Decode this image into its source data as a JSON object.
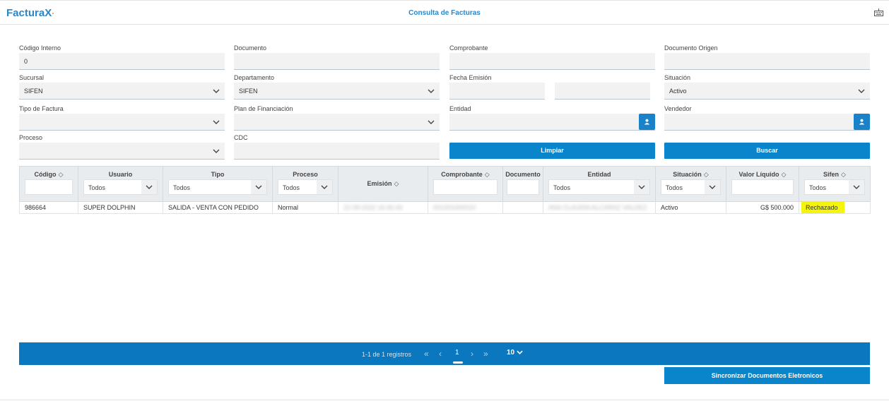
{
  "app": {
    "logo_main": "Factura",
    "logo_x": "X",
    "logo_dot": "·",
    "title": "Consulta de Facturas"
  },
  "filters": {
    "codigo_interno": {
      "label": "Código Interno",
      "value": "0"
    },
    "documento": {
      "label": "Documento",
      "value": ""
    },
    "comprobante": {
      "label": "Comprobante",
      "value": ""
    },
    "documento_origen": {
      "label": "Documento Origen",
      "value": ""
    },
    "sucursal": {
      "label": "Sucursal",
      "value": "SIFEN"
    },
    "departamento": {
      "label": "Departamento",
      "value": "SIFEN"
    },
    "fecha_emision": {
      "label": "Fecha Emisión",
      "from": "",
      "to": ""
    },
    "situacion": {
      "label": "Situación",
      "value": "Activo"
    },
    "tipo_factura": {
      "label": "Tipo de Factura",
      "value": ""
    },
    "plan_financiacion": {
      "label": "Plan de Financiación",
      "value": ""
    },
    "entidad": {
      "label": "Entidad",
      "value": ""
    },
    "vendedor": {
      "label": "Vendedor",
      "value": ""
    },
    "proceso": {
      "label": "Proceso",
      "value": ""
    },
    "cdc": {
      "label": "CDC",
      "value": ""
    }
  },
  "buttons": {
    "limpiar": "Limpiar",
    "buscar": "Buscar",
    "sincronizar": "Sincronizar Documentos Eletronicos"
  },
  "table": {
    "headers": {
      "codigo": "Código",
      "usuario": "Usuario",
      "tipo": "Tipo",
      "proceso": "Proceso",
      "emision": "Emisión",
      "comprobante": "Comprobante",
      "documento": "Documento",
      "entidad": "Entidad",
      "situacion": "Situación",
      "valor_liquido": "Valor Líquido",
      "sifen": "Sifen"
    },
    "filter_all": "Todos",
    "rows": [
      {
        "codigo": "986664",
        "usuario": "SUPER DOLPHIN",
        "tipo": "SALIDA - VENTA CON PEDIDO",
        "proceso": "Normal",
        "emision": "22-09-2022 16:45:46",
        "comprobante": "001001000010",
        "documento": "",
        "entidad": "ANA CLAUDIA ALCARAZ VALDEZ",
        "situacion": "Activo",
        "valor_liquido": "G$ 500.000",
        "sifen": "Rechazado"
      }
    ]
  },
  "pager": {
    "info": "1-1 de 1 registros",
    "page": "1",
    "size": "10"
  },
  "colors": {
    "accent": "#0a85cc",
    "pager": "#0a77bf",
    "highlight": "#f5f50a"
  }
}
